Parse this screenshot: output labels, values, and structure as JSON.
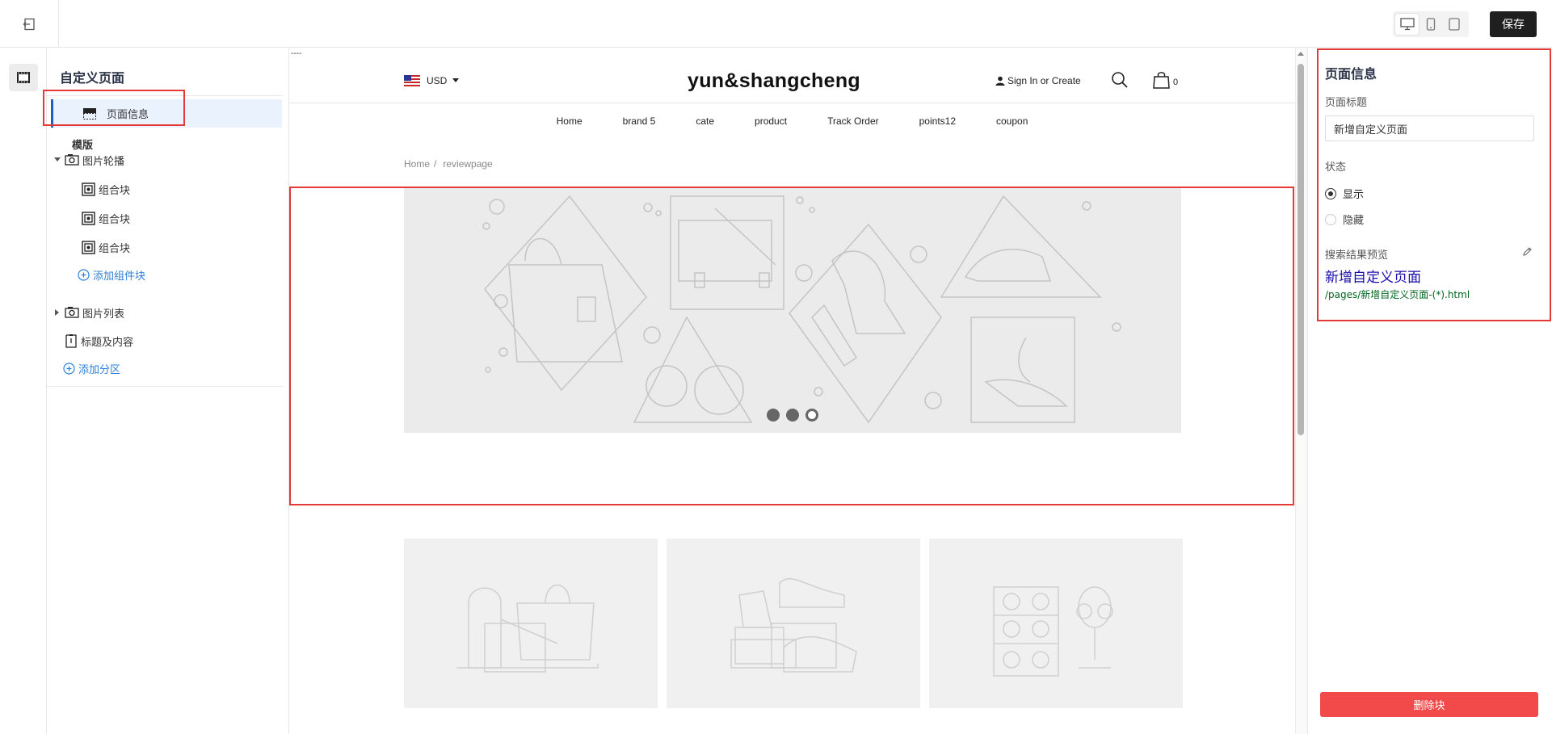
{
  "toolbar": {
    "save_label": "保存",
    "device_modes": [
      "desktop",
      "mobile",
      "tablet"
    ],
    "active_device": "desktop"
  },
  "sidebar": {
    "title": "自定义页面",
    "page_info_label": "页面信息",
    "template_label": "模版",
    "sections": [
      {
        "label": "图片轮播",
        "expanded": true,
        "blocks": [
          "组合块",
          "组合块",
          "组合块"
        ],
        "add_block_label": "添加组件块"
      },
      {
        "label": "图片列表",
        "expanded": false
      },
      {
        "label": "标题及内容"
      }
    ],
    "add_section_label": "添加分区"
  },
  "preview": {
    "top_marker": "----",
    "currency": "USD",
    "store_title": "yun&shangcheng",
    "sign_in": "Sign In or Create",
    "cart_count": "0",
    "nav": [
      "Home",
      "brand 5",
      "cate",
      "product",
      "Track Order",
      "points12",
      "coupon"
    ],
    "breadcrumb": [
      "Home",
      "reviewpage"
    ],
    "slideshow_dots": 3,
    "active_dot": 3
  },
  "panel": {
    "title": "页面信息",
    "page_title_label": "页面标题",
    "page_title_value": "新增自定义页面",
    "status_label": "状态",
    "status_options": [
      "显示",
      "隐藏"
    ],
    "status_selected": "显示",
    "seo_label": "搜索结果预览",
    "seo_title": "新增自定义页面",
    "seo_url": "/pages/新增自定义页面-(*).html",
    "delete_label": "删除块"
  },
  "colors": {
    "highlight": "#e53935",
    "delete": "#f24a4a",
    "link": "#2f7fd8",
    "seo_title": "#1a0dab",
    "seo_url": "#006621"
  }
}
